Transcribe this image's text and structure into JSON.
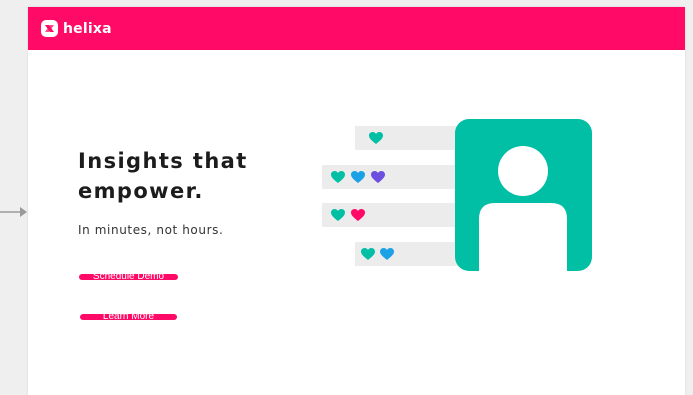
{
  "brand": {
    "name": "helixa",
    "color": "#ff0a66"
  },
  "hero": {
    "headline_line1": "Insights that",
    "headline_line2": "empower.",
    "subhead": "In minutes, not hours."
  },
  "buttons": {
    "schedule_demo": "Schedule Demo",
    "learn_more": "Learn More"
  },
  "illustration": {
    "rows": [
      {
        "hearts": [
          "teal"
        ]
      },
      {
        "hearts": [
          "teal",
          "blue",
          "purple"
        ]
      },
      {
        "hearts": [
          "teal",
          "pink"
        ]
      },
      {
        "hearts": [
          "teal",
          "blue"
        ]
      }
    ],
    "colors": {
      "teal": "#00bfa5",
      "blue": "#1ca0e6",
      "purple": "#6d4fe0",
      "pink": "#ff0a66"
    },
    "avatar_icon": "user-profile-icon"
  },
  "icons": {
    "left_edge": "arrow-right-icon",
    "logo": "helixa-logo-icon"
  }
}
